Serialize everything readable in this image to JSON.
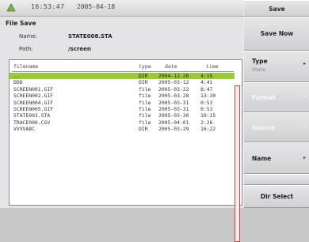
{
  "status": {
    "time": "16:53:47",
    "date": "2005-04-18"
  },
  "panel": {
    "title": "File Save",
    "name_label": "Name:",
    "name_value": "STATE008.STA",
    "path_label": "Path:",
    "path_value": "/screen"
  },
  "list": {
    "headers": {
      "filename": "filename",
      "type": "type",
      "date": "date",
      "time": "time"
    },
    "rows": [
      {
        "filename": "..",
        "type": "DIR",
        "date": "2004-12-28",
        "time": "4:15",
        "selected": true
      },
      {
        "filename": "DDD",
        "type": "DIR",
        "date": "2005-03-12",
        "time": "4:41"
      },
      {
        "filename": "SCREEN001.GIF",
        "type": "file",
        "date": "2005-03-22",
        "time": "8:47"
      },
      {
        "filename": "SCREEN002.GIF",
        "type": "file",
        "date": "2005-03-28",
        "time": "13:30"
      },
      {
        "filename": "SCREEN004.GIF",
        "type": "file",
        "date": "2005-03-31",
        "time": "0:53"
      },
      {
        "filename": "SCREEN005.GIF",
        "type": "file",
        "date": "2005-03-31",
        "time": "0:53"
      },
      {
        "filename": "STATE003.STA",
        "type": "file",
        "date": "2005-03-30",
        "time": "10:15"
      },
      {
        "filename": "TRACE006.CSV",
        "type": "file",
        "date": "2005-04-01",
        "time": "2:26"
      },
      {
        "filename": "VVVVABC",
        "type": "DIR",
        "date": "2005-03-29",
        "time": "16:22"
      }
    ]
  },
  "softkeys": {
    "save": "Save",
    "save_now": "Save Now",
    "type": "Type",
    "type_sub": "State",
    "format": "Format",
    "source": "Source",
    "name": "Name",
    "dir_select": "Dir Select",
    "arrow": "▸"
  }
}
